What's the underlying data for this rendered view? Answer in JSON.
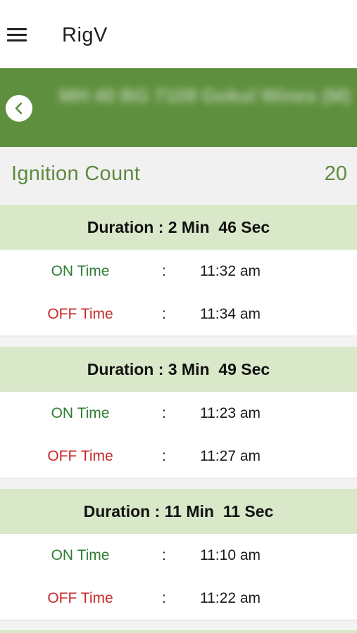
{
  "appbar": {
    "title": "RigV",
    "menu_icon": "hamburger-menu-icon"
  },
  "vehicle": {
    "name": "MH 40 BG 7109 Gokul Wines (M)",
    "back_icon": "chevron-left-icon",
    "header_color": "#5e8f3e"
  },
  "ignition": {
    "label": "Ignition Count",
    "count": "20"
  },
  "sessions": [
    {
      "duration": "Duration : 2 Min  46 Sec",
      "on_label": "ON Time",
      "on_value": "11:32 am",
      "off_label": "OFF Time",
      "off_value": "11:34 am"
    },
    {
      "duration": "Duration : 3 Min  49 Sec",
      "on_label": "ON Time",
      "on_value": "11:23 am",
      "off_label": "OFF Time",
      "off_value": "11:27 am"
    },
    {
      "duration": "Duration : 11 Min  11 Sec",
      "on_label": "ON Time",
      "on_value": "11:10 am",
      "off_label": "OFF Time",
      "off_value": "11:22 am"
    }
  ],
  "separator": ":",
  "colors": {
    "accent_green": "#5f8a3d",
    "on_green": "#2e7d32",
    "off_red": "#c62828",
    "card_head_bg": "#d9e8c9"
  }
}
